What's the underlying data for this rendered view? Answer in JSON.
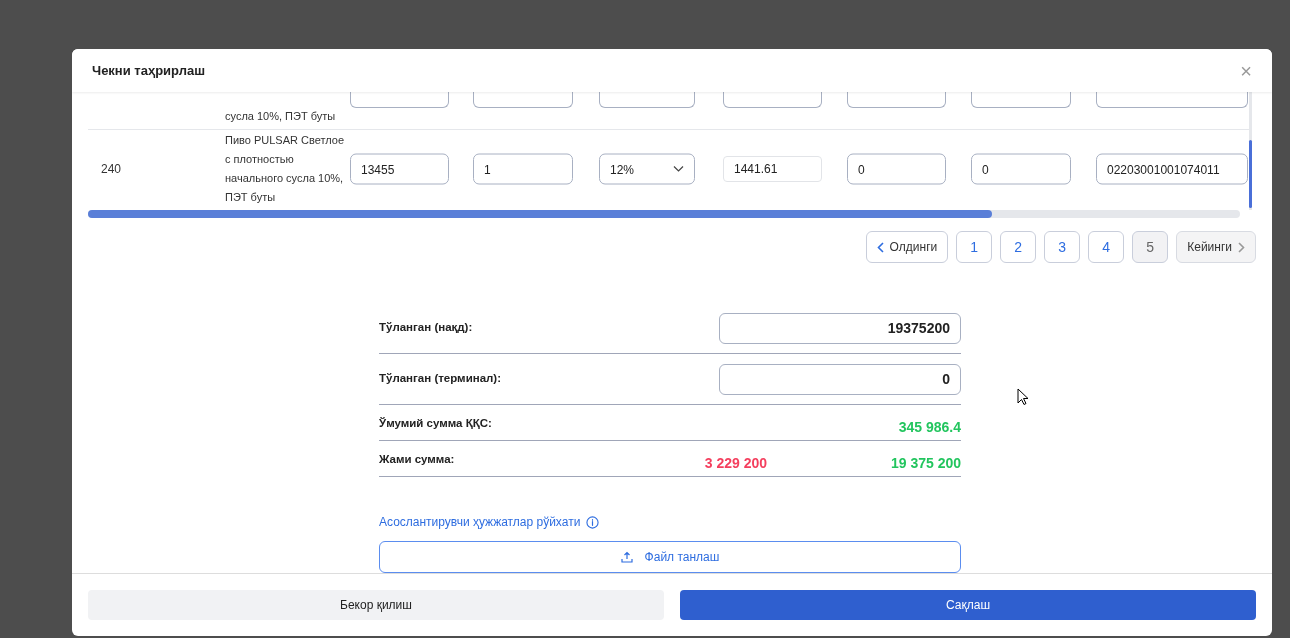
{
  "dialog": {
    "title": "Чекни таҳрирлаш",
    "close": "×"
  },
  "table": {
    "partial_row": {
      "name": "сусла 10%, ПЭТ буты"
    },
    "rows": [
      {
        "number": "240",
        "name": "Пиво PULSAR Светлое с плотностью начального сусла 10%, ПЭТ буты",
        "price": "13455",
        "quantity": "1",
        "vat": "12%",
        "vat_amount": "1441.61",
        "column_7": "0",
        "column_8": "0",
        "code": "02203001001074011"
      }
    ],
    "horizontal_scroll": {
      "level": 0.785
    }
  },
  "pagination": {
    "prev": "Олдинги",
    "next": "Кейинги",
    "pages": [
      {
        "label": "1",
        "selected": false
      },
      {
        "label": "2",
        "selected": false
      },
      {
        "label": "3",
        "selected": false
      },
      {
        "label": "4",
        "selected": false
      },
      {
        "label": "5",
        "selected": true
      }
    ]
  },
  "summary": [
    {
      "kind": "input",
      "label": "Тўланган (нақд):",
      "value": "19375200"
    },
    {
      "kind": "input",
      "label": "Тўланган (терминал):",
      "value": "0"
    },
    {
      "kind": "amount",
      "label": "Ўмумий сумма ҚҚС:",
      "amounts": [
        {
          "text": "345 986.4",
          "color": "#22c55e"
        }
      ]
    },
    {
      "kind": "amount",
      "label": "Жами сумма:",
      "amounts": [
        {
          "text": "3 229 200",
          "color": "#f43f5e"
        },
        {
          "text": "19 375 200",
          "color": "#22c55e"
        }
      ]
    }
  ],
  "documents": {
    "label": "Асослантирувчи ҳужжатлар рўйхати",
    "button": "Файл танлаш"
  },
  "footer": {
    "cancel": "Бекор қилиш",
    "save": "Сақлаш"
  }
}
